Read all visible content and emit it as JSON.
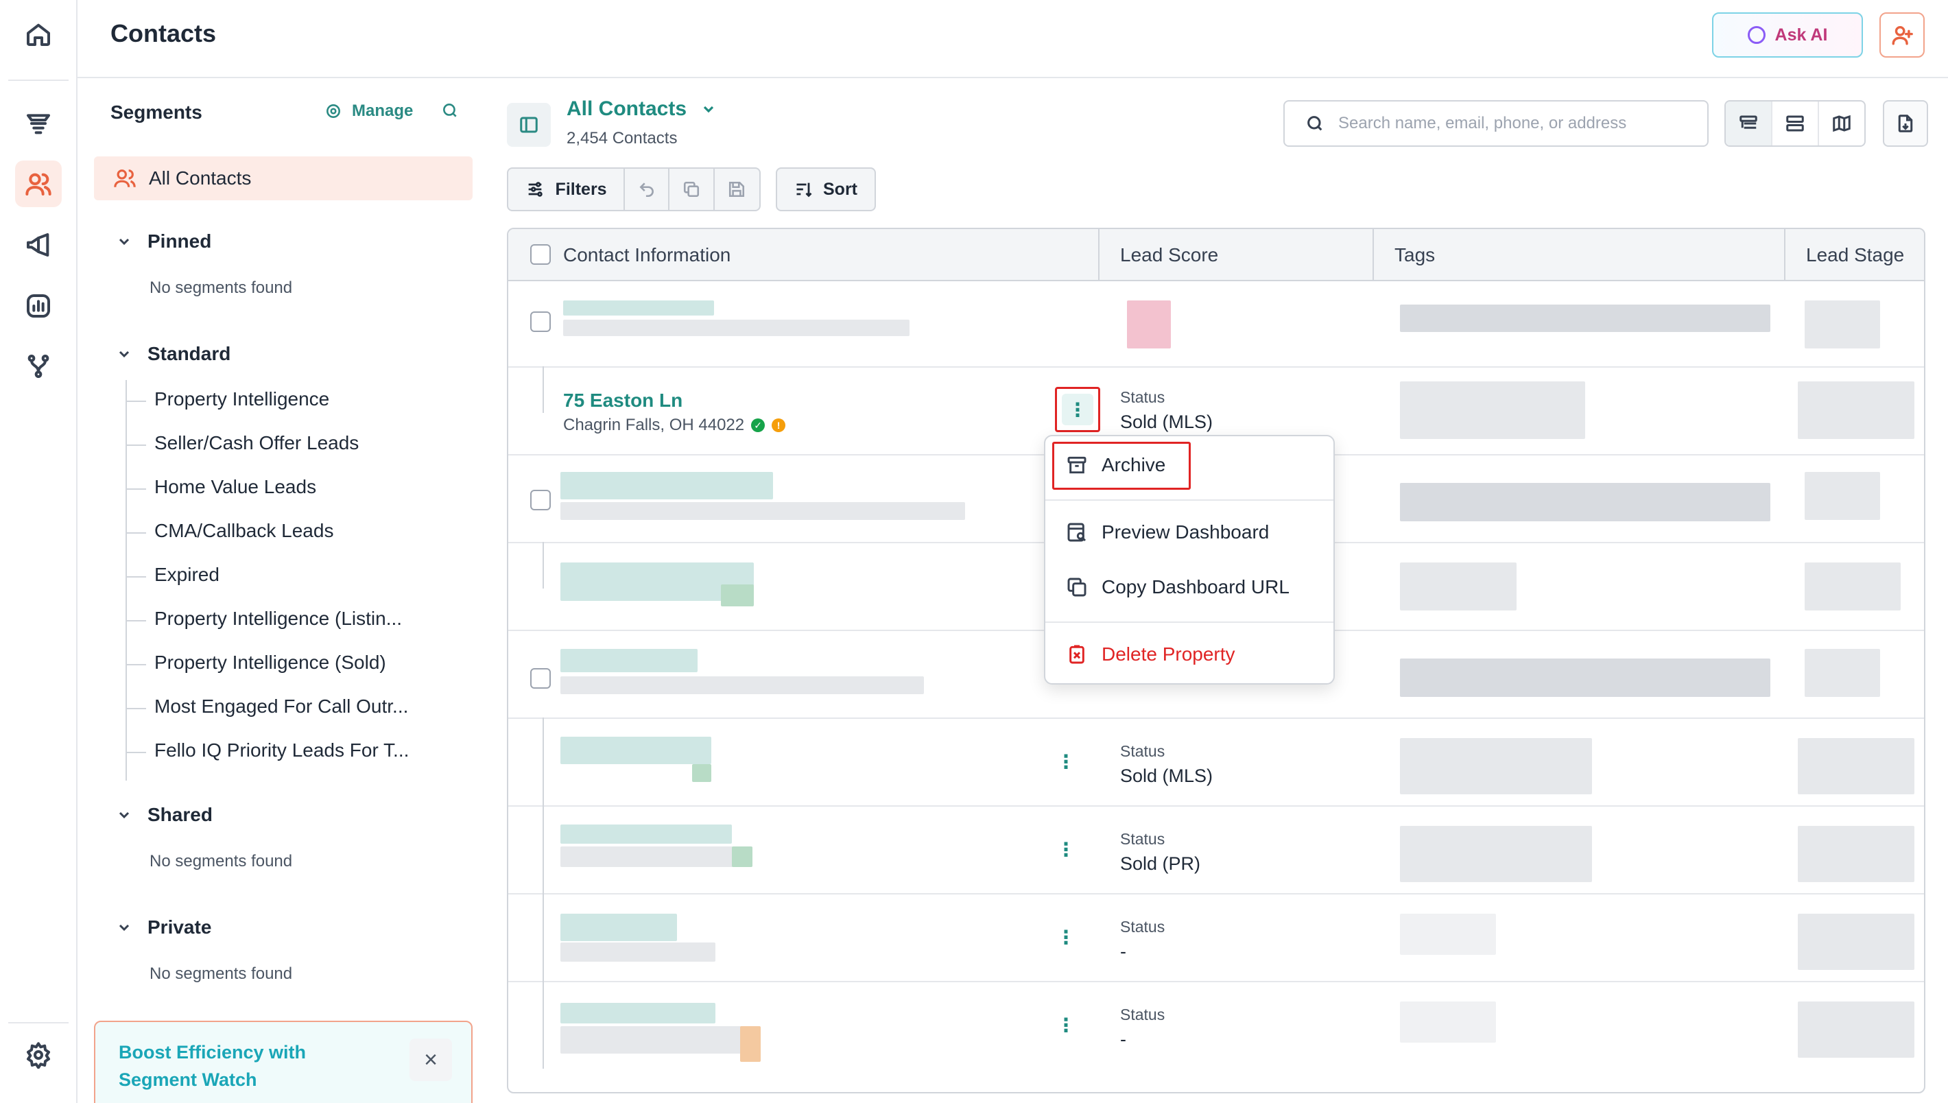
{
  "header": {
    "title": "Contacts",
    "ask_ai_label": "Ask AI"
  },
  "rail": {
    "icons": [
      "home-icon",
      "funnel-icon",
      "contacts-icon",
      "megaphone-icon",
      "analytics-icon",
      "workflow-icon",
      "settings-icon"
    ]
  },
  "segments": {
    "title": "Segments",
    "manage_label": "Manage",
    "all_contacts": "All Contacts",
    "groups": {
      "pinned": {
        "label": "Pinned",
        "empty": "No segments found"
      },
      "standard": {
        "label": "Standard",
        "items": [
          "Property Intelligence",
          "Seller/Cash Offer Leads",
          "Home Value Leads",
          "CMA/Callback Leads",
          "Expired",
          "Property Intelligence (Listin...",
          "Property Intelligence (Sold)",
          "Most Engaged For Call Outr...",
          "Fello IQ Priority Leads For T..."
        ]
      },
      "shared": {
        "label": "Shared",
        "empty": "No segments found"
      },
      "private": {
        "label": "Private",
        "empty": "No segments found"
      }
    },
    "promo": {
      "text": "Boost Efficiency with Segment Watch",
      "close": "×"
    }
  },
  "main": {
    "view_title": "All Contacts",
    "count": "2,454 Contacts",
    "search_placeholder": "Search name, email, phone, or address",
    "filters_label": "Filters",
    "sort_label": "Sort"
  },
  "table": {
    "columns": [
      "Contact Information",
      "Lead Score",
      "Tags",
      "Lead Stage"
    ],
    "rows": [
      {
        "kind": "contact"
      },
      {
        "kind": "property",
        "title": "75 Easton Ln",
        "subtitle": "Chagrin Falls, OH 44022",
        "status_label": "Status",
        "status_value": "Sold (MLS)"
      },
      {
        "kind": "contact"
      },
      {
        "kind": "property"
      },
      {
        "kind": "contact"
      },
      {
        "kind": "property",
        "status_label": "Status",
        "status_value": "Sold (MLS)"
      },
      {
        "kind": "property",
        "status_label": "Status",
        "status_value": "Sold (PR)"
      },
      {
        "kind": "property",
        "status_label": "Status",
        "status_value": "-"
      },
      {
        "kind": "property",
        "status_label": "Status",
        "status_value": "-"
      }
    ]
  },
  "context_menu": {
    "items": [
      {
        "label": "Archive",
        "icon": "archive-icon"
      },
      {
        "label": "Preview Dashboard",
        "icon": "preview-dashboard-icon"
      },
      {
        "label": "Copy Dashboard URL",
        "icon": "copy-icon"
      },
      {
        "label": "Delete Property",
        "icon": "delete-icon"
      }
    ]
  },
  "colors": {
    "accent": "#1f8b80",
    "brand": "#e8623f",
    "danger": "#e02424"
  }
}
